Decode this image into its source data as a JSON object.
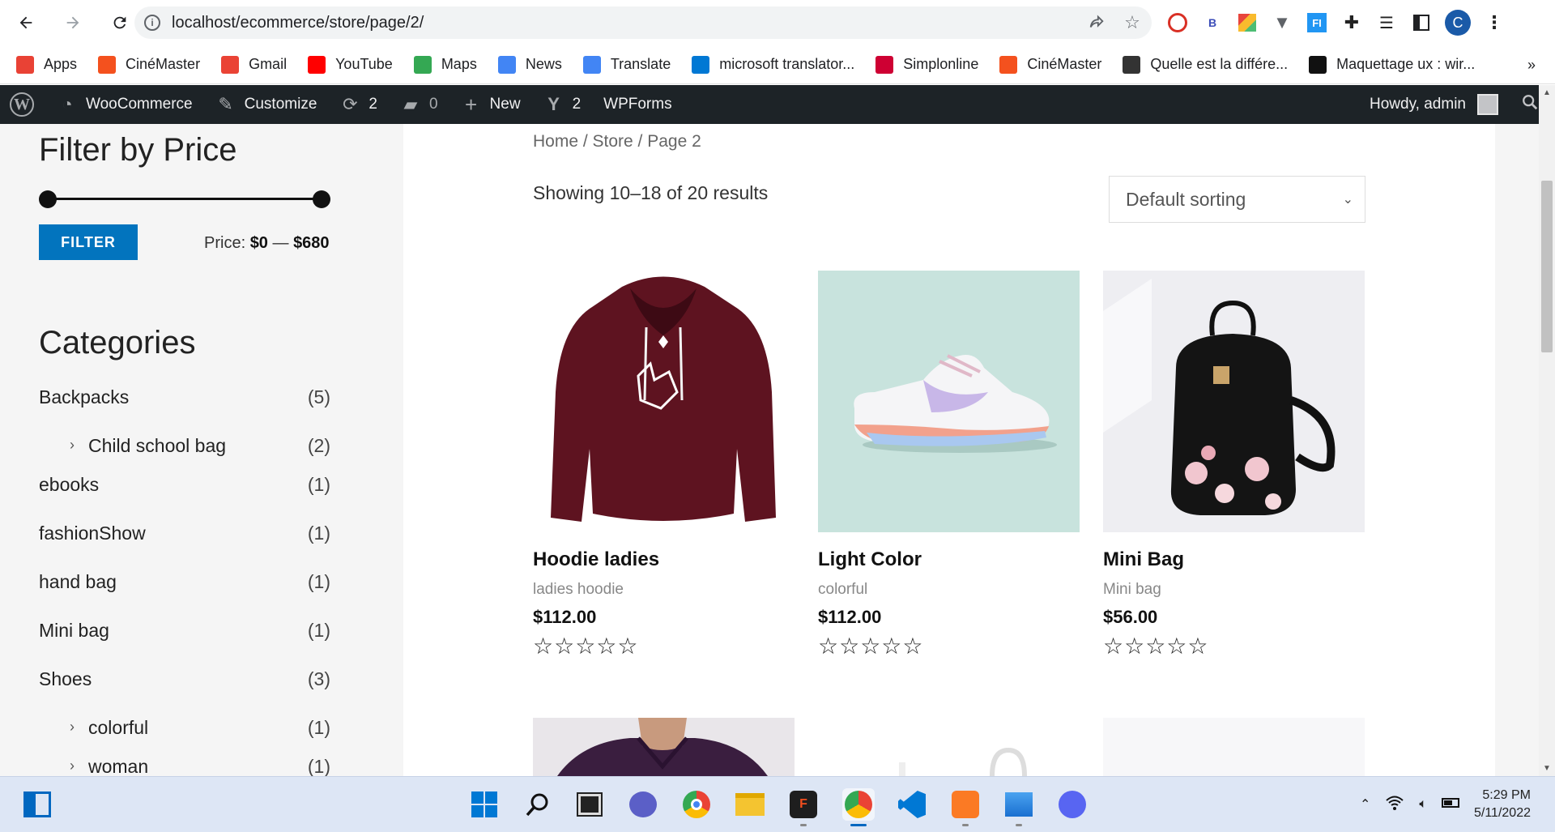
{
  "browser": {
    "url": "localhost/ecommerce/store/page/2/",
    "profile_initial": "C",
    "bookmarks": [
      {
        "label": "Apps",
        "icon": "apps-grid-icon",
        "color": "#e94235"
      },
      {
        "label": "CinéMaster",
        "icon": "cinemaster-icon",
        "color": "#f4511e"
      },
      {
        "label": "Gmail",
        "icon": "gmail-icon",
        "color": "#ea4335"
      },
      {
        "label": "YouTube",
        "icon": "youtube-icon",
        "color": "#ff0000"
      },
      {
        "label": "Maps",
        "icon": "maps-icon",
        "color": "#34a853"
      },
      {
        "label": "News",
        "icon": "news-icon",
        "color": "#4285f4"
      },
      {
        "label": "Translate",
        "icon": "translate-icon",
        "color": "#4285f4"
      },
      {
        "label": "microsoft translator...",
        "icon": "bing-icon",
        "color": "#0078d4"
      },
      {
        "label": "Simplonline",
        "icon": "simplonline-icon",
        "color": "#ce0033"
      },
      {
        "label": "CinéMaster",
        "icon": "cinemaster-icon",
        "color": "#f4511e"
      },
      {
        "label": "Quelle est la différe...",
        "icon": "ux-icon",
        "color": "#333333"
      },
      {
        "label": "Maquettage ux : wir...",
        "icon": "amazon-icon",
        "color": "#111111"
      }
    ],
    "bookmarks_more": "»"
  },
  "adminbar": {
    "items": [
      {
        "label": "WooCommerce",
        "icon": "dashboard-icon"
      },
      {
        "label": "Customize",
        "icon": "brush-icon"
      },
      {
        "label": "2",
        "icon": "updates-icon"
      },
      {
        "label": "0",
        "icon": "comments-icon"
      },
      {
        "label": "New",
        "icon": "plus-icon"
      },
      {
        "label": "2",
        "icon": "yoast-icon"
      },
      {
        "label": "WPForms",
        "icon": ""
      }
    ],
    "howdy": "Howdy, admin"
  },
  "sidebar": {
    "price_title": "Filter by Price",
    "filter_button": "FILTER",
    "price_label": "Price:",
    "price_min": "$0",
    "price_sep": "—",
    "price_max": "$680",
    "categories_title": "Categories",
    "categories": [
      {
        "name": "Backpacks",
        "count": "(5)",
        "child": false
      },
      {
        "name": "Child school bag",
        "count": "(2)",
        "child": true
      },
      {
        "name": "ebooks",
        "count": "(1)",
        "child": false
      },
      {
        "name": "fashionShow",
        "count": "(1)",
        "child": false
      },
      {
        "name": "hand bag",
        "count": "(1)",
        "child": false
      },
      {
        "name": "Mini bag",
        "count": "(1)",
        "child": false
      },
      {
        "name": "Shoes",
        "count": "(3)",
        "child": false
      },
      {
        "name": "colorful",
        "count": "(1)",
        "child": true
      },
      {
        "name": "woman",
        "count": "(1)",
        "child": true
      }
    ]
  },
  "main": {
    "breadcrumb": "Home / Store / Page 2",
    "result_count": "Showing 10–18 of 20 results",
    "sort_value": "Default sorting",
    "products": [
      {
        "title": "Hoodie ladies",
        "category": "ladies hoodie",
        "price": "$112.00",
        "stars": "☆☆☆☆☆"
      },
      {
        "title": "Light Color",
        "category": "colorful",
        "price": "$112.00",
        "stars": "☆☆☆☆☆"
      },
      {
        "title": "Mini Bag",
        "category": "Mini bag",
        "price": "$56.00",
        "stars": "☆☆☆☆☆"
      }
    ]
  },
  "taskbar": {
    "time": "5:29 PM",
    "date": "5/11/2022"
  },
  "colors": {
    "accent": "#0274be",
    "adminbar": "#1d2327",
    "sidebar_bg": "#f5f5f5"
  }
}
